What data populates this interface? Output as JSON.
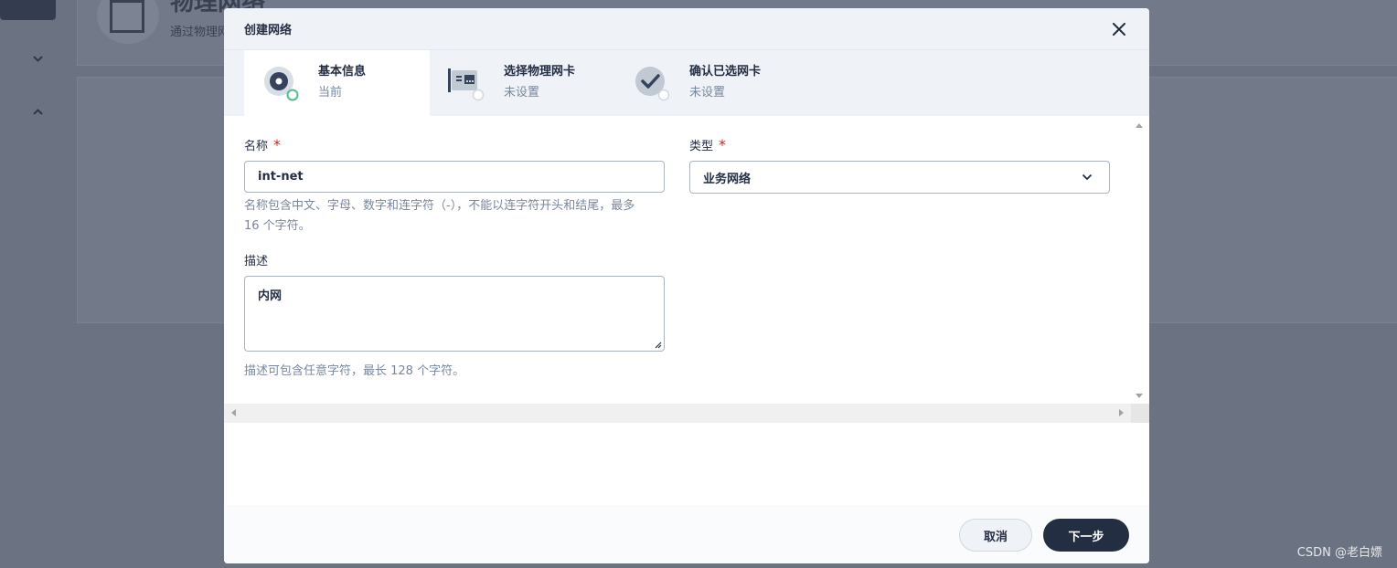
{
  "background": {
    "page_title": "物理网络",
    "page_subtitle": "通过物理网"
  },
  "modal": {
    "title": "创建网络",
    "steps": [
      {
        "title": "基本信息",
        "desc": "当前"
      },
      {
        "title": "选择物理网卡",
        "desc": "未设置"
      },
      {
        "title": "确认已选网卡",
        "desc": "未设置"
      }
    ],
    "form": {
      "name_label": "名称",
      "required_mark": "*",
      "name_value": "int-net",
      "name_help_line1": "名称包含中文、字母、数字和连字符（-），不能以连字符开头和结尾，最多",
      "name_help_line2": "16 个字符。",
      "type_label": "类型",
      "type_value": "业务网络",
      "desc_label": "描述",
      "desc_value": "内网",
      "desc_help": "描述可包含任意字符，最长 128 个字符。"
    },
    "footer": {
      "cancel_label": "取消",
      "next_label": "下一步"
    }
  },
  "watermark": "CSDN @老白嫖",
  "colors": {
    "primary": "#242e42",
    "success": "#55bc8a",
    "required": "#ca2621",
    "header_bg": "#eff3f8"
  }
}
